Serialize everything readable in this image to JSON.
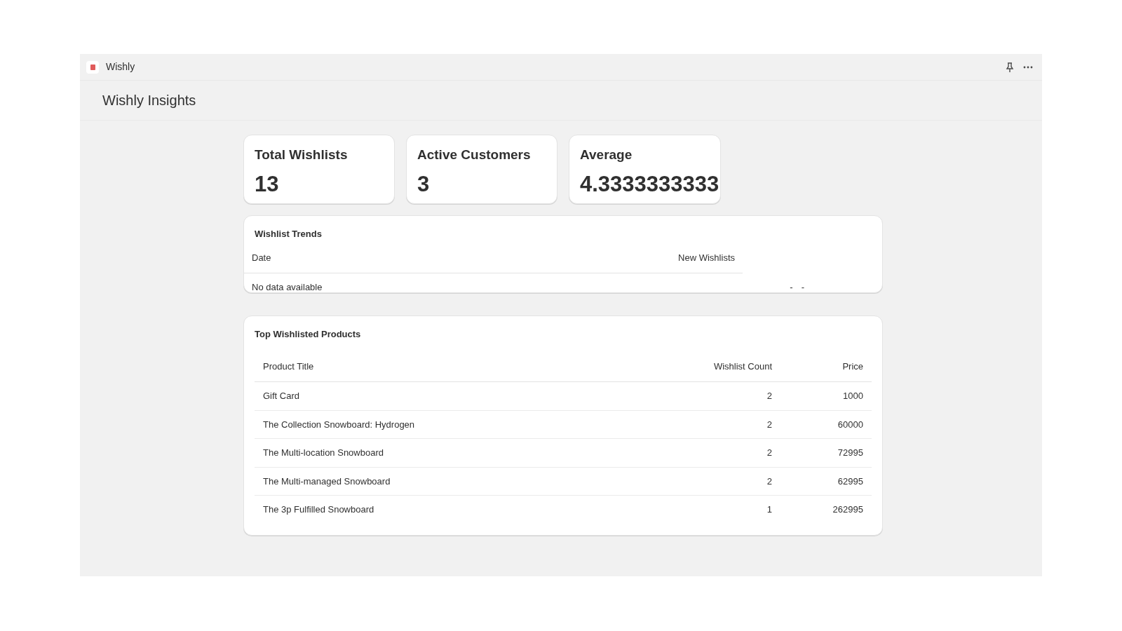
{
  "window": {
    "title": "Wishly"
  },
  "page": {
    "title": "Wishly Insights"
  },
  "stats": [
    {
      "label": "Total Wishlists",
      "value": "13"
    },
    {
      "label": "Active Customers",
      "value": "3"
    },
    {
      "label": "Average",
      "value": "4.3333333333"
    }
  ],
  "trends": {
    "title": "Wishlist Trends",
    "columns": [
      "Date",
      "New Wishlists"
    ],
    "empty_text": "No data available",
    "trailing": [
      "-",
      "-"
    ]
  },
  "products": {
    "title": "Top Wishlisted Products",
    "columns": [
      "Product Title",
      "Wishlist Count",
      "Price"
    ],
    "rows": [
      [
        "Gift Card",
        "2",
        "1000"
      ],
      [
        "The Collection Snowboard: Hydrogen",
        "2",
        "60000"
      ],
      [
        "The Multi-location Snowboard",
        "2",
        "72995"
      ],
      [
        "The Multi-managed Snowboard",
        "2",
        "62995"
      ],
      [
        "The 3p Fulfilled Snowboard",
        "1",
        "262995"
      ]
    ]
  }
}
